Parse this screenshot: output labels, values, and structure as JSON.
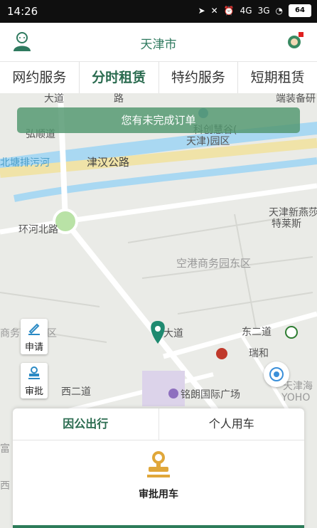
{
  "status_bar": {
    "time": "14:26",
    "signal_4g": "4G",
    "signal_3g": "3G",
    "battery": "64"
  },
  "header": {
    "city": "天津市"
  },
  "tabs": [
    {
      "label": "网约服务"
    },
    {
      "label": "分时租赁",
      "active": true
    },
    {
      "label": "特约服务"
    },
    {
      "label": "短期租赁"
    }
  ],
  "banner": {
    "text": "您有未完成订单"
  },
  "map_labels": [
    "大道",
    "路",
    "科创慧谷(",
    "天津)园区",
    "弘顺道",
    "端装备研",
    "北塘排污河",
    "津汉公路",
    "天津新燕莎",
    "特莱斯",
    "环河北路",
    "空港商务园东区",
    "东二道",
    "商务",
    "区",
    "大道",
    "瑞和",
    "天津海",
    "YOHO",
    "西二道",
    "铭朗国际广场",
    "富",
    "西"
  ],
  "side_buttons": {
    "apply": "申请",
    "approve": "审批"
  },
  "panel": {
    "tabs": [
      {
        "label": "因公出行",
        "active": true
      },
      {
        "label": "个人用车"
      }
    ],
    "action_label": "审批用车"
  },
  "colors": {
    "brand_green": "#2a6b4f",
    "banner_green": "#5a9a74",
    "accent_gold": "#e0a73a"
  }
}
